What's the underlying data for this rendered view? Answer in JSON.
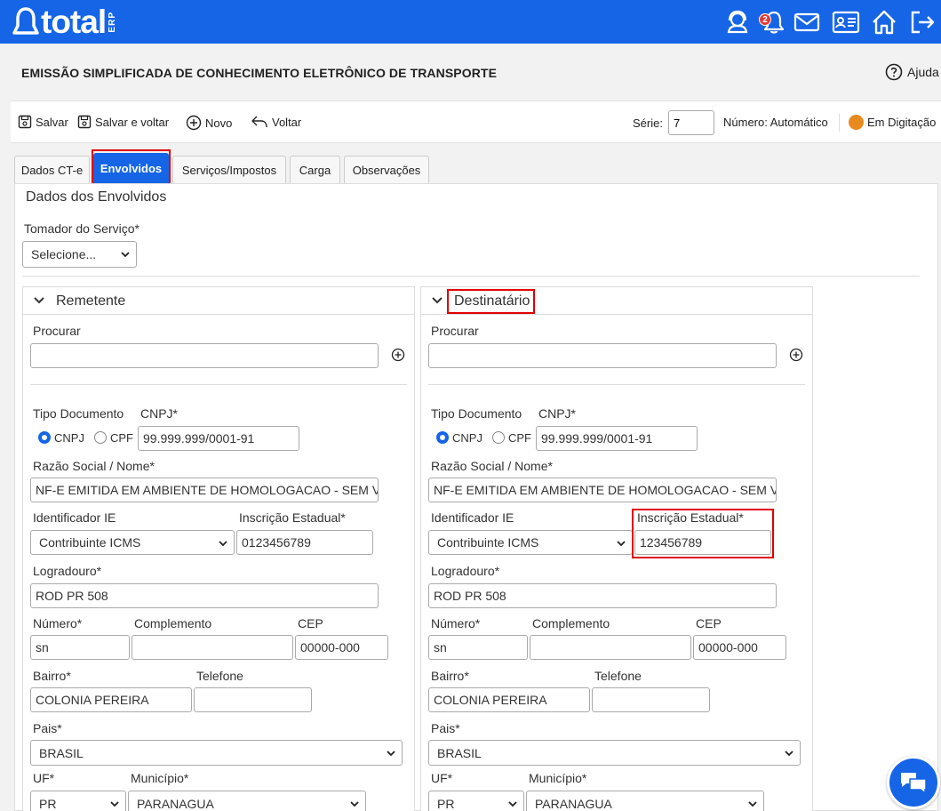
{
  "header": {
    "logo_text": "total",
    "logo_sub": "ERP",
    "notification_count": "2",
    "icons": [
      "support-agent-icon",
      "bell-icon",
      "mail-icon",
      "id-card-icon",
      "home-icon",
      "logout-icon"
    ]
  },
  "page": {
    "title": "EMISSÃO SIMPLIFICADA DE CONHECIMENTO ELETRÔNICO DE TRANSPORTE",
    "help_label": "Ajuda"
  },
  "toolbar": {
    "save_label": "Salvar",
    "save_back_label": "Salvar e voltar",
    "new_label": "Novo",
    "back_label": "Voltar",
    "serie_label": "Série:",
    "serie_value": "7",
    "numero_label": "Número: Automático",
    "status_label": "Em Digitação",
    "status_color": "#e98a1f"
  },
  "tabs": [
    {
      "label": "Dados CT-e"
    },
    {
      "label": "Envolvidos"
    },
    {
      "label": "Serviços/Impostos"
    },
    {
      "label": "Carga"
    },
    {
      "label": "Observações"
    }
  ],
  "content": {
    "section_title": "Dados dos Envolvidos",
    "tomador_label": "Tomador do Serviço*",
    "tomador_value": "Selecione..."
  },
  "remetente": {
    "title": "Remetente",
    "procurar_label": "Procurar",
    "procurar_value": "",
    "tipo_doc_label": "Tipo Documento",
    "cnpj_label": "CNPJ*",
    "radio_cnpj": "CNPJ",
    "radio_cpf": "CPF",
    "cnpj_value": "99.999.999/0001-91",
    "razao_label": "Razão Social / Nome*",
    "razao_value": "NF-E EMITIDA EM AMBIENTE DE HOMOLOGACAO - SEM VALOR FISCAL",
    "ident_ie_label": "Identificador IE",
    "ident_ie_value": "Contribuinte ICMS",
    "ie_label": "Inscrição Estadual*",
    "ie_value": "0123456789",
    "logradouro_label": "Logradouro*",
    "logradouro_value": "ROD PR 508",
    "numero_label": "Número*",
    "numero_value": "sn",
    "complemento_label": "Complemento",
    "complemento_value": "",
    "cep_label": "CEP",
    "cep_value": "00000-000",
    "bairro_label": "Bairro*",
    "bairro_value": "COLONIA PEREIRA",
    "telefone_label": "Telefone",
    "telefone_value": "",
    "pais_label": "Pais*",
    "pais_value": "BRASIL",
    "uf_label": "UF*",
    "uf_value": "PR",
    "municipio_label": "Município*",
    "municipio_value": "PARANAGUA"
  },
  "destinatario": {
    "title": "Destinatário",
    "procurar_label": "Procurar",
    "procurar_value": "",
    "tipo_doc_label": "Tipo Documento",
    "cnpj_label": "CNPJ*",
    "radio_cnpj": "CNPJ",
    "radio_cpf": "CPF",
    "cnpj_value": "99.999.999/0001-91",
    "razao_label": "Razão Social / Nome*",
    "razao_value": "NF-E EMITIDA EM AMBIENTE DE HOMOLOGACAO - SEM VALOR FISCAL",
    "ident_ie_label": "Identificador IE",
    "ident_ie_value": "Contribuinte ICMS",
    "ie_label": "Inscrição Estadual*",
    "ie_value": "123456789",
    "logradouro_label": "Logradouro*",
    "logradouro_value": "ROD PR 508",
    "numero_label": "Número*",
    "numero_value": "sn",
    "complemento_label": "Complemento",
    "complemento_value": "",
    "cep_label": "CEP",
    "cep_value": "00000-000",
    "bairro_label": "Bairro*",
    "bairro_value": "COLONIA PEREIRA",
    "telefone_label": "Telefone",
    "telefone_value": "",
    "pais_label": "Pais*",
    "pais_value": "BRASIL",
    "uf_label": "UF*",
    "uf_value": "PR",
    "municipio_label": "Município*",
    "municipio_value": "PARANAGUA"
  },
  "colors": {
    "brand": "#1565e6",
    "highlight": "#e00000"
  }
}
